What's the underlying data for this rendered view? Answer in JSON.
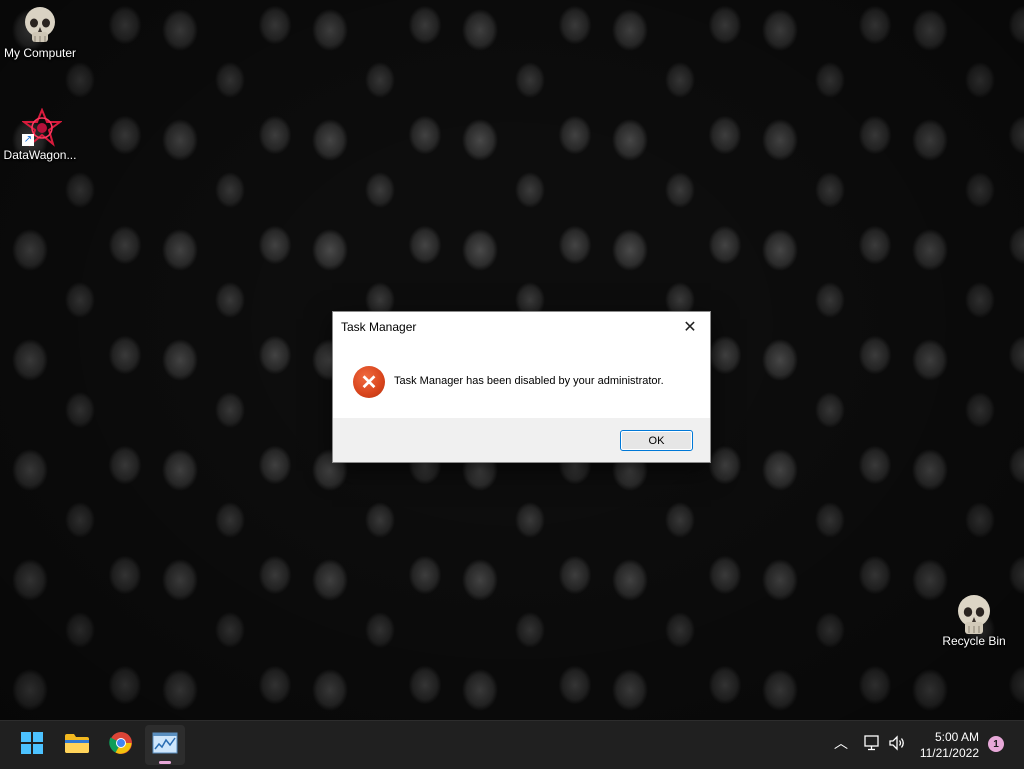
{
  "desktop": {
    "icons": [
      {
        "label": "My Computer",
        "icon": "skull-icon"
      },
      {
        "label": "DataWagon...",
        "icon": "datawagon-app-icon"
      },
      {
        "label": "Recycle Bin",
        "icon": "skull-icon"
      }
    ]
  },
  "dialog": {
    "title": "Task Manager",
    "close_glyph": "✕",
    "error_glyph": "✕",
    "message": "Task Manager has been disabled by your administrator.",
    "ok_label": "OK"
  },
  "taskbar": {
    "items": [
      {
        "name": "start-button",
        "icon": "windows-logo-icon"
      },
      {
        "name": "file-explorer",
        "icon": "folder-icon"
      },
      {
        "name": "chrome",
        "icon": "chrome-icon"
      },
      {
        "name": "task-manager",
        "icon": "task-manager-icon",
        "active": true
      }
    ],
    "tray": {
      "chevron": "︿",
      "time": "5:00 AM",
      "date": "11/21/2022",
      "notification_count": "1"
    }
  },
  "colors": {
    "accent": "#0078d7",
    "error": "#d8441c",
    "taskbar": "#202020",
    "active_indicator": "#e7a8d8"
  }
}
